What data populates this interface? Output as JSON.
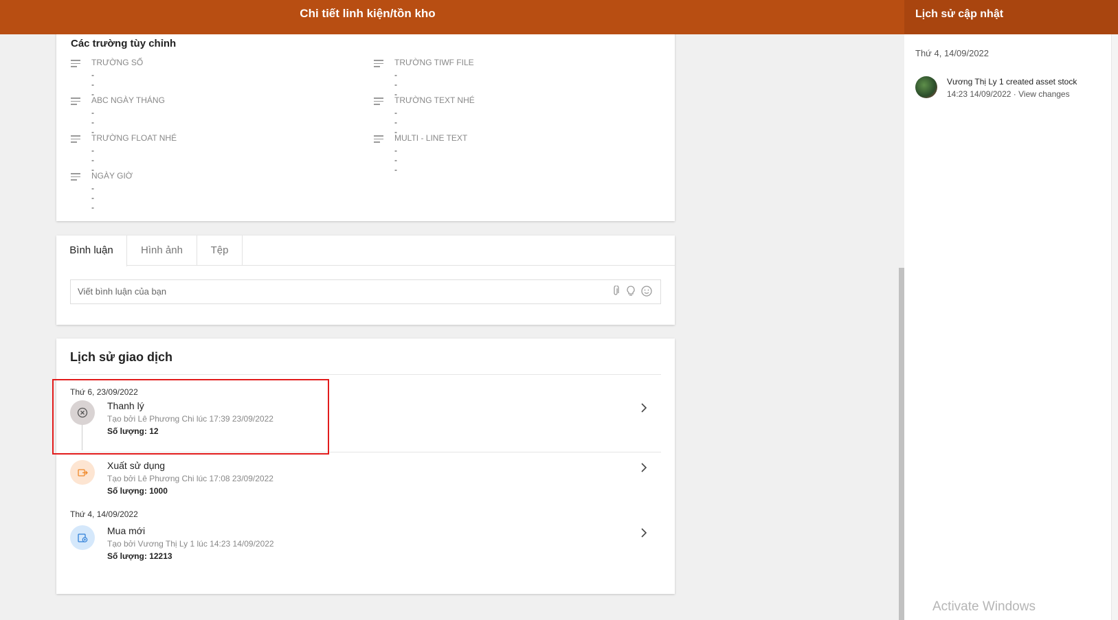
{
  "header": {
    "title": "Chi tiết linh kiện/tồn kho"
  },
  "custom_fields": {
    "title": "Các trường tùy chỉnh",
    "fields": [
      {
        "label": "TRƯỜNG SỐ",
        "value": "---"
      },
      {
        "label": "TRƯỜNG TIWF FILE",
        "value": "---"
      },
      {
        "label": "ABC NGÀY THÁNG",
        "value": "---"
      },
      {
        "label": "TRƯỜNG TEXT NHÉ",
        "value": "---"
      },
      {
        "label": "TRƯỜNG FLOAT NHÉ",
        "value": "---"
      },
      {
        "label": "MULTI - LINE TEXT",
        "value": "---"
      },
      {
        "label": "NGÀY GIỜ",
        "value": "---"
      }
    ]
  },
  "comments": {
    "tabs": [
      {
        "label": "Bình luận",
        "active": true
      },
      {
        "label": "Hình ảnh",
        "active": false
      },
      {
        "label": "Tệp",
        "active": false
      }
    ],
    "placeholder": "Viết bình luận của bạn",
    "icons": [
      "paperclip-icon",
      "lightbulb-icon",
      "smiley-icon"
    ]
  },
  "transaction_history": {
    "title": "Lịch sử giao dịch",
    "groups": [
      {
        "date": "Thứ 6, 23/09/2022",
        "entries": [
          {
            "title": "Thanh lý",
            "meta": "Tạo bởi Lê Phương Chi lúc 17:39 23/09/2022",
            "quantity": "Số lượng: 12",
            "icon": "cancel-circle-icon",
            "icon_color": "#555555",
            "icon_bg": "#d9d3d3"
          },
          {
            "title": "Xuất sử dụng",
            "meta": "Tạo bởi Lê Phương Chi lúc 17:08 23/09/2022",
            "quantity": "Số lượng: 1000",
            "icon": "export-icon",
            "icon_color": "#ef8a2c",
            "icon_bg": "#fde5d2"
          }
        ]
      },
      {
        "date": "Thứ 4, 14/09/2022",
        "entries": [
          {
            "title": "Mua mới",
            "meta": "Tạo bởi Vương Thị Ly 1 lúc 14:23 14/09/2022",
            "quantity": "Số lượng: 12213",
            "icon": "new-purchase-icon",
            "icon_color": "#2f7fd8",
            "icon_bg": "#d5e8fb"
          }
        ]
      }
    ]
  },
  "update_history": {
    "title": "Lịch sử cập nhật",
    "date": "Thứ 4, 14/09/2022",
    "entry": {
      "user": "Vương Thị Ly 1",
      "action": "created asset stock",
      "time": "14:23 14/09/2022",
      "link": "View changes"
    }
  },
  "watermark": {
    "line1": "Activate Windows"
  },
  "colors": {
    "header": "#b84e12",
    "right_header": "#a9450f",
    "highlight_border": "#e21b1b"
  }
}
